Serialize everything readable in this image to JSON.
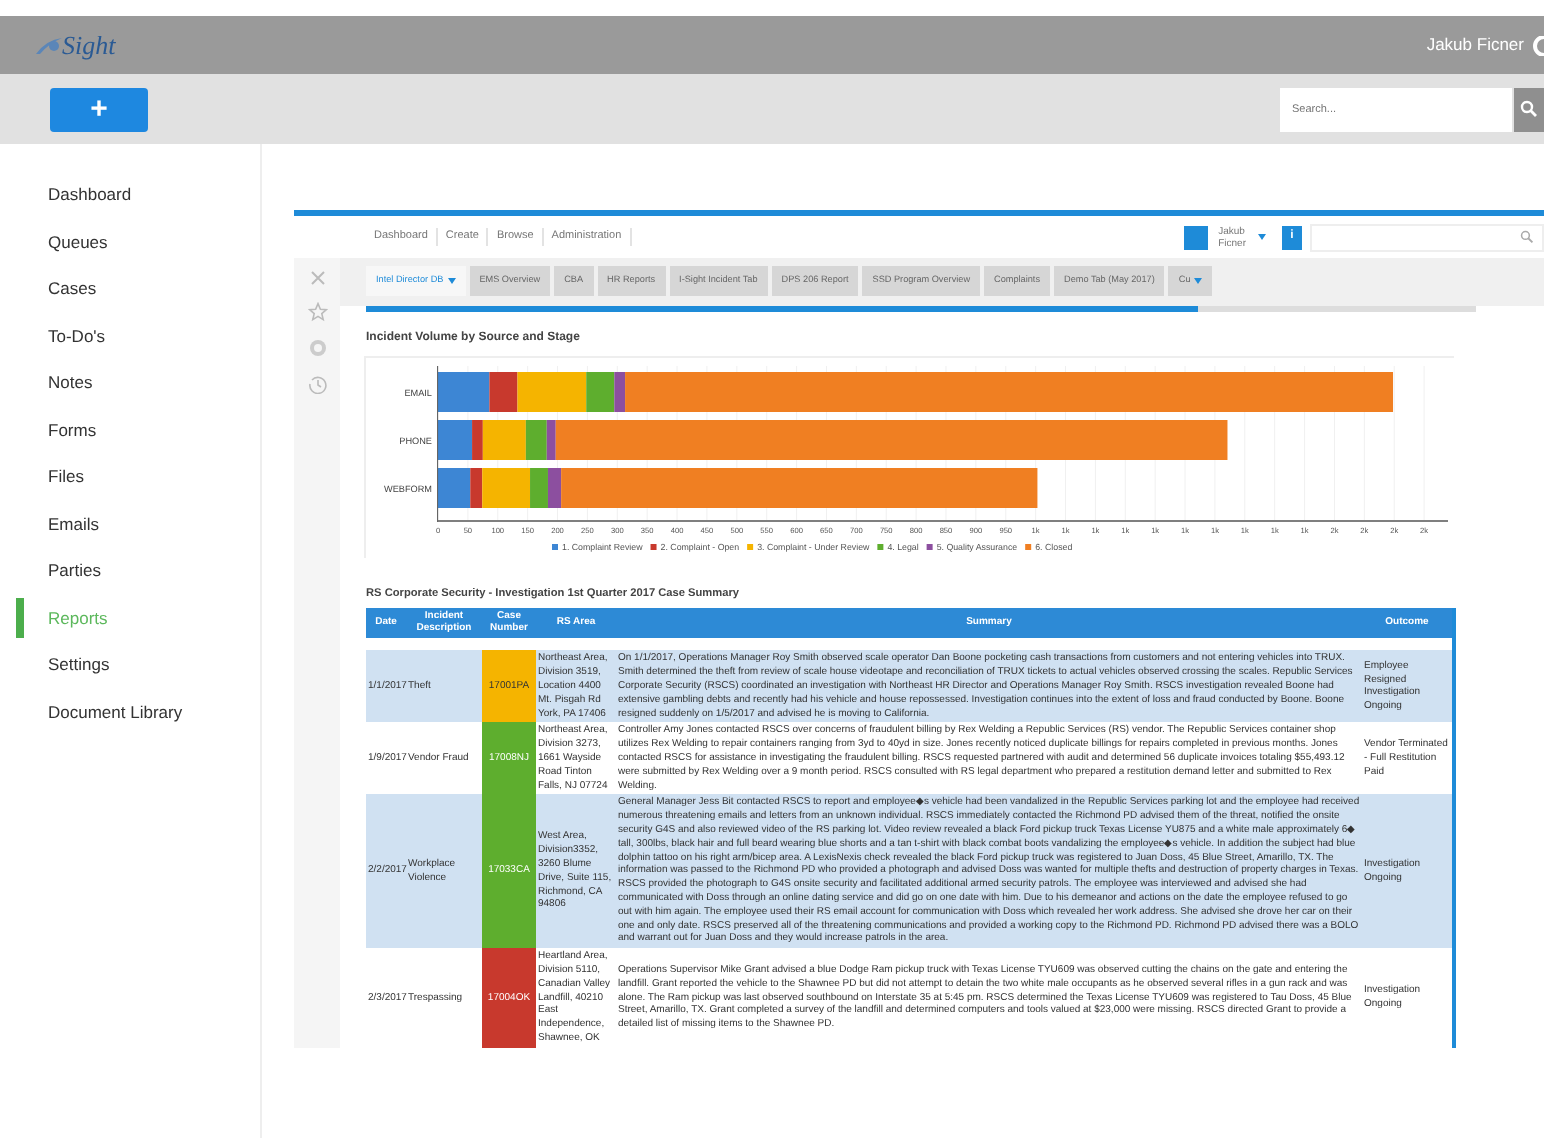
{
  "app": {
    "logo": "Sight",
    "user": "Jakub Ficner",
    "add_button": "+",
    "search": {
      "placeholder": "Search..."
    }
  },
  "sidebar": {
    "items": [
      {
        "label": "Dashboard",
        "selected": false
      },
      {
        "label": "Queues",
        "selected": false
      },
      {
        "label": "Cases",
        "selected": false
      },
      {
        "label": "To-Do's",
        "selected": false
      },
      {
        "label": "Notes",
        "selected": false
      },
      {
        "label": "Forms",
        "selected": false
      },
      {
        "label": "Files",
        "selected": false
      },
      {
        "label": "Emails",
        "selected": false
      },
      {
        "label": "Parties",
        "selected": false
      },
      {
        "label": "Reports",
        "selected": true
      },
      {
        "label": "Settings",
        "selected": false
      },
      {
        "label": "Document Library",
        "selected": false
      }
    ]
  },
  "embedded": {
    "nav": [
      "Dashboard",
      "Create",
      "Browse",
      "Administration"
    ],
    "user": {
      "first_name": "Jakub",
      "last_name": "Ficner"
    },
    "info_button": "i",
    "tabs": [
      {
        "label": "Intel Director DB",
        "selected": true,
        "dropdown": true
      },
      {
        "label": "EMS Overview",
        "selected": false,
        "dropdown": false
      },
      {
        "label": "CBA",
        "selected": false,
        "dropdown": false
      },
      {
        "label": "HR Reports",
        "selected": false,
        "dropdown": false
      },
      {
        "label": "I-Sight Incident Tab",
        "selected": false,
        "dropdown": false
      },
      {
        "label": "DPS 206 Report",
        "selected": false,
        "dropdown": false
      },
      {
        "label": "SSD Program Overview",
        "selected": false,
        "dropdown": false
      },
      {
        "label": "Complaints",
        "selected": false,
        "dropdown": false
      },
      {
        "label": "Demo Tab (May 2017)",
        "selected": false,
        "dropdown": false
      },
      {
        "label": "Cu",
        "selected": false,
        "dropdown": true
      }
    ],
    "chart": {
      "title": "Incident Volume by Source and Stage",
      "chart_data": {
        "type": "bar",
        "orientation": "horizontal",
        "stacked": true,
        "grid": true,
        "legend": true,
        "categories": [
          "EMAIL",
          "PHONE",
          "WEBFORM"
        ],
        "xlim": [
          0,
          1690
        ],
        "xticks": [
          0,
          50,
          100,
          150,
          200,
          250,
          300,
          350,
          400,
          450,
          500,
          550,
          600,
          650,
          700,
          750,
          800,
          850,
          900,
          950,
          {
            "value": 1000,
            "label": "1k"
          },
          {
            "value": 1050,
            "label": "1k"
          },
          {
            "value": 1100,
            "label": "1k"
          },
          {
            "value": 1150,
            "label": "1k"
          },
          {
            "value": 1200,
            "label": "1k"
          },
          {
            "value": 1250,
            "label": "1k"
          },
          {
            "value": 1300,
            "label": "1k"
          },
          {
            "value": 1350,
            "label": "1k"
          },
          {
            "value": 1400,
            "label": "1k"
          },
          {
            "value": 1450,
            "label": "1k"
          },
          {
            "value": 1500,
            "label": "2k"
          },
          {
            "value": 1550,
            "label": "2k"
          },
          {
            "value": 1600,
            "label": "2k"
          },
          {
            "value": 1650,
            "label": "2k"
          }
        ],
        "series": [
          {
            "name": "1. Complaint Review",
            "color": "#3d86d4",
            "values": [
              86,
              57,
              54
            ]
          },
          {
            "name": "2. Complaint - Open",
            "color": "#c8392d",
            "values": [
              47,
              18,
              20
            ]
          },
          {
            "name": "3. Complaint - Under Review",
            "color": "#f5b400",
            "values": [
              115,
              72,
              80
            ]
          },
          {
            "name": "4. Legal",
            "color": "#5eae2e",
            "values": [
              47,
              35,
              30
            ]
          },
          {
            "name": "5. Quality Assurance",
            "color": "#8c4f9f",
            "values": [
              18,
              15,
              22
            ]
          },
          {
            "name": "6. Closed",
            "color": "#f07f22",
            "values": [
              1285,
              1124,
              797
            ]
          }
        ]
      }
    },
    "table": {
      "title": "RS Corporate Security - Investigation 1st Quarter 2017 Case Summary",
      "columns": [
        "Date",
        "Incident Description",
        "Case Number",
        "RS Area",
        "Summary",
        "Outcome"
      ],
      "rows": [
        {
          "date": "1/1/2017",
          "incident": "Theft",
          "case_number": "17001PA",
          "color": "#f5b400",
          "rs_area": "Northeast Area, Division 3519, Location 4400 Mt. Pisgah Rd York, PA 17406",
          "summary": "On 1/1/2017, Operations Manager Roy Smith observed scale operator Dan Boone pocketing cash transactions from customers and not entering vehicles into TRUX. Smith determined the theft from review of scale house videotape and reconciliation of TRUX tickets to actual vehicles observed crossing the scales. Republic Services Corporate Security (RSCS) coordinated an investigation with Northeast HR Director and Operations Manager Roy Smith. RSCS investigation revealed Boone had extensive gambling debts and recently had his vehicle and house repossessed. Investigation continues into the extent of loss and fraud conducted by Boone. Boone resigned suddenly on 1/5/2017 and advised he is moving to California.",
          "outcome": "Employee Resigned Investigation Ongoing"
        },
        {
          "date": "1/9/2017",
          "incident": "Vendor Fraud",
          "case_number": "17008NJ",
          "color": "#5eae2e",
          "rs_area": "Northeast Area, Division 3273, 1661 Wayside Road Tinton Falls, NJ 07724",
          "summary": "Controller Amy Jones contacted RSCS over concerns of fraudulent billing by Rex Welding a Republic Services (RS) vendor. The Republic Services container shop utilizes Rex Welding to repair containers ranging from 3yd to 40yd in size. Jones recently noticed duplicate billings for repairs completed in previous months. Jones contacted RSCS for assistance in investigating the fraudulent billing. RSCS requested partnered with audit and determined 56 duplicate invoices totaling $55,493.12 were submitted by Rex Welding over a 9 month period. RSCS consulted with RS legal department who prepared a restitution demand letter and submitted to Rex Welding.",
          "outcome": "Vendor Terminated - Full Restitution Paid"
        },
        {
          "date": "2/2/2017",
          "incident": "Workplace Violence",
          "case_number": "17033CA",
          "color": "#5eae2e",
          "rs_area": "West Area, Division3352, 3260 Blume Drive, Suite 115, Richmond, CA 94806",
          "summary": "General Manager Jess Bit contacted RSCS to report and employee◆s vehicle had been vandalized in the Republic Services parking lot and the employee had received numerous threatening emails and letters from an unknown individual. RSCS immediately contacted the Richmond PD advised them of the threat, notified the onsite security G4S and also reviewed video of the RS parking lot. Video review revealed a black Ford pickup truck Texas License YU875 and a white male approximately 6◆ tall, 300lbs, black hair and full beard wearing blue shorts and a tan t-shirt with black combat boots vandalizing the employee◆s vehicle. In addition the subject had blue dolphin tattoo on his right arm/bicep area. A LexisNexis check revealed the black Ford pickup truck was registered to Juan Doss, 45 Blue Street, Amarillo, TX. The information was passed to the Richmond PD who provided a photograph and advised Doss was wanted for multiple thefts and destruction of property charges in Texas. RSCS provided the photograph to G4S onsite security and facilitated additional armed security patrols. The employee was interviewed and advised she had communicated with Doss through an online dating service and did go on one date with him. Due to his demeanor and actions on the date the employee refused to go out with him again. The employee used their RS email account for communication with Doss which revealed her work address. She advised she drove her car on their one and only date. RSCS preserved all of the threatening communications and provided a working copy to the Richmond PD. Richmond PD advised there was a BOLO and warrant out for Juan Doss and they would increase patrols in the area.",
          "outcome": "Investigation Ongoing"
        },
        {
          "date": "2/3/2017",
          "incident": "Trespassing",
          "case_number": "17004OK",
          "color": "#c8392d",
          "rs_area": "Heartland Area, Division 5110, Canadian Valley Landfill, 40210 East Independence, Shawnee, OK",
          "summary": "Operations Supervisor Mike Grant advised a blue Dodge Ram pickup truck with Texas License TYU609 was observed cutting the chains on the gate and entering the landfill. Grant reported the vehicle to the Shawnee PD but did not attempt to detain the two white male occupants as he observed several rifles in a gun rack and was alone. The Ram pickup was last observed southbound on Interstate 35 at 5:45 pm. RSCS determined the Texas License TYU609 was registered to Tau Doss, 45 Blue Street, Amarillo, TX. Grant completed a survey of the landfill and determined computers and tools valued at $23,000 were missing. RSCS directed Grant to provide a detailed list of missing items to the Shawnee PD.",
          "outcome": "Investigation Ongoing"
        }
      ]
    }
  }
}
